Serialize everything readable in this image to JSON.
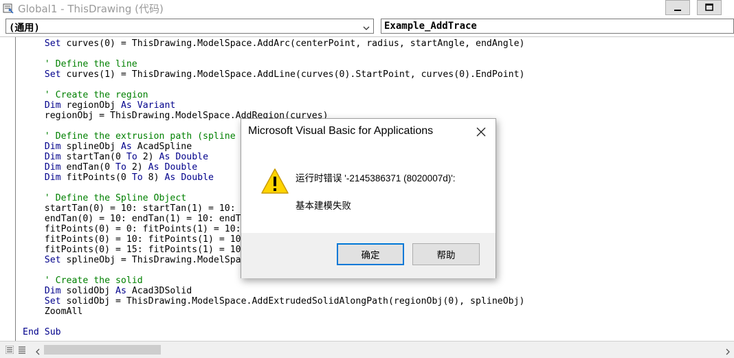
{
  "window": {
    "title": "Global1 - ThisDrawing (代码)",
    "icon": "vba-module-icon",
    "controls": [
      "minimize-icon",
      "restore-icon"
    ]
  },
  "object_dropdown": {
    "value": "(通用)"
  },
  "procedure_dropdown": {
    "value": "Example_AddTrace"
  },
  "code": {
    "lines": [
      [
        {
          "t": "    "
        },
        {
          "k": "Set"
        },
        {
          "t": " curves(0) = ThisDrawing.ModelSpace.AddArc(centerPoint, radius, startAngle, endAngle)"
        }
      ],
      [
        {
          "t": ""
        }
      ],
      [
        {
          "t": "    "
        },
        {
          "c": "' Define the line"
        }
      ],
      [
        {
          "t": "    "
        },
        {
          "k": "Set"
        },
        {
          "t": " curves(1) = ThisDrawing.ModelSpace.AddLine(curves(0).StartPoint, curves(0).EndPoint)"
        }
      ],
      [
        {
          "t": ""
        }
      ],
      [
        {
          "t": "    "
        },
        {
          "c": "' Create the region"
        }
      ],
      [
        {
          "t": "    "
        },
        {
          "k": "Dim"
        },
        {
          "t": " regionObj "
        },
        {
          "k": "As"
        },
        {
          "t": " "
        },
        {
          "k": "Variant"
        }
      ],
      [
        {
          "t": "    regionObj = ThisDrawing.ModelSpace.AddRegion(curves)"
        }
      ],
      [
        {
          "t": ""
        }
      ],
      [
        {
          "t": "    "
        },
        {
          "c": "' Define the extrusion path (spline"
        }
      ],
      [
        {
          "t": "    "
        },
        {
          "k": "Dim"
        },
        {
          "t": " splineObj "
        },
        {
          "k": "As"
        },
        {
          "t": " AcadSpline"
        }
      ],
      [
        {
          "t": "    "
        },
        {
          "k": "Dim"
        },
        {
          "t": " startTan(0 "
        },
        {
          "k": "To"
        },
        {
          "t": " 2) "
        },
        {
          "k": "As"
        },
        {
          "t": " "
        },
        {
          "k": "Double"
        }
      ],
      [
        {
          "t": "    "
        },
        {
          "k": "Dim"
        },
        {
          "t": " endTan(0 "
        },
        {
          "k": "To"
        },
        {
          "t": " 2) "
        },
        {
          "k": "As"
        },
        {
          "t": " "
        },
        {
          "k": "Double"
        }
      ],
      [
        {
          "t": "    "
        },
        {
          "k": "Dim"
        },
        {
          "t": " fitPoints(0 "
        },
        {
          "k": "To"
        },
        {
          "t": " 8) "
        },
        {
          "k": "As"
        },
        {
          "t": " "
        },
        {
          "k": "Double"
        }
      ],
      [
        {
          "t": ""
        }
      ],
      [
        {
          "t": "    "
        },
        {
          "c": "' Define the Spline Object"
        }
      ],
      [
        {
          "t": "    startTan(0) = 10: startTan(1) = 10:"
        }
      ],
      [
        {
          "t": "    endTan(0) = 10: endTan(1) = 10: endT"
        }
      ],
      [
        {
          "t": "    fitPoints(0) = 0: fitPoints(1) = 10:"
        }
      ],
      [
        {
          "t": "    fitPoints(0) = 10: fitPoints(1) = 10"
        }
      ],
      [
        {
          "t": "    fitPoints(0) = 15: fitPoints(1) = 10"
        }
      ],
      [
        {
          "t": "    "
        },
        {
          "k": "Set"
        },
        {
          "t": " splineObj = ThisDrawing.ModelSpa"
        }
      ],
      [
        {
          "t": ""
        }
      ],
      [
        {
          "t": "    "
        },
        {
          "c": "' Create the solid"
        }
      ],
      [
        {
          "t": "    "
        },
        {
          "k": "Dim"
        },
        {
          "t": " solidObj "
        },
        {
          "k": "As"
        },
        {
          "t": " Acad3DSolid"
        }
      ],
      [
        {
          "t": "    "
        },
        {
          "k": "Set"
        },
        {
          "t": " solidObj = ThisDrawing.ModelSpace.AddExtrudedSolidAlongPath(regionObj(0), splineObj)"
        }
      ],
      [
        {
          "t": "    ZoomAll"
        }
      ],
      [
        {
          "t": ""
        }
      ],
      [
        {
          "k": "End Sub"
        }
      ]
    ]
  },
  "dialog": {
    "title": "Microsoft Visual Basic for Applications",
    "icon": "warning-icon",
    "message_line1": "运行时错误 '-2145386371 (8020007d)':",
    "message_line2": "基本建模失败",
    "ok_label": "确定",
    "help_label": "帮助"
  },
  "colors": {
    "keyword": "#00008b",
    "comment": "#008000",
    "primary_button_border": "#0078d7",
    "warning_fill": "#ffd400"
  }
}
